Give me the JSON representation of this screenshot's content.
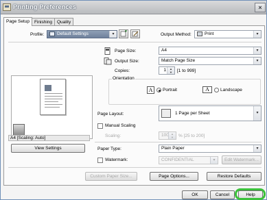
{
  "window": {
    "title": "Printing Preferences",
    "close_glyph": "×"
  },
  "tabs": [
    {
      "label": "Page Setup",
      "active": true
    },
    {
      "label": "Finishing",
      "active": false
    },
    {
      "label": "Quality",
      "active": false
    }
  ],
  "profile": {
    "label": "Profile:",
    "value": "Default Settings"
  },
  "output_method": {
    "label": "Output Method:",
    "value": "Print"
  },
  "page_size": {
    "label": "Page Size:",
    "value": "A4"
  },
  "output_size": {
    "label": "Output Size:",
    "value": "Match Page Size"
  },
  "copies": {
    "label": "Copies:",
    "value": "1",
    "range": "[1 to 999]"
  },
  "orientation": {
    "legend": "Orientation",
    "portrait_label": "Portrait",
    "landscape_label": "Landscape",
    "portrait_glyph": "A",
    "landscape_glyph": "A",
    "selected": "Portrait"
  },
  "page_layout": {
    "label": "Page Layout:",
    "value": "1 Page per Sheet"
  },
  "manual_scaling": {
    "label": "Manual Scaling",
    "checked": false
  },
  "scaling": {
    "label": "Scaling:",
    "value": "100",
    "range": "% [25 to 200]"
  },
  "preview": {
    "status": "A4 [Scaling: Auto]"
  },
  "view_settings_label": "View Settings",
  "paper_type": {
    "label": "Paper Type:",
    "value": "Plain Paper"
  },
  "watermark": {
    "label": "Watermark:",
    "checked": false,
    "value": "CONFIDENTIAL",
    "edit_label": "Edit Watermark..."
  },
  "buttons": {
    "custom_paper_size": "Custom Paper Size...",
    "page_options": "Page Options...",
    "restore_defaults": "Restore Defaults",
    "ok": "OK",
    "cancel": "Cancel",
    "help": "Help"
  },
  "colors": {
    "highlight": "#3bc13b",
    "title_bar": "#c4c6c9",
    "panel": "#fbfbfb"
  }
}
